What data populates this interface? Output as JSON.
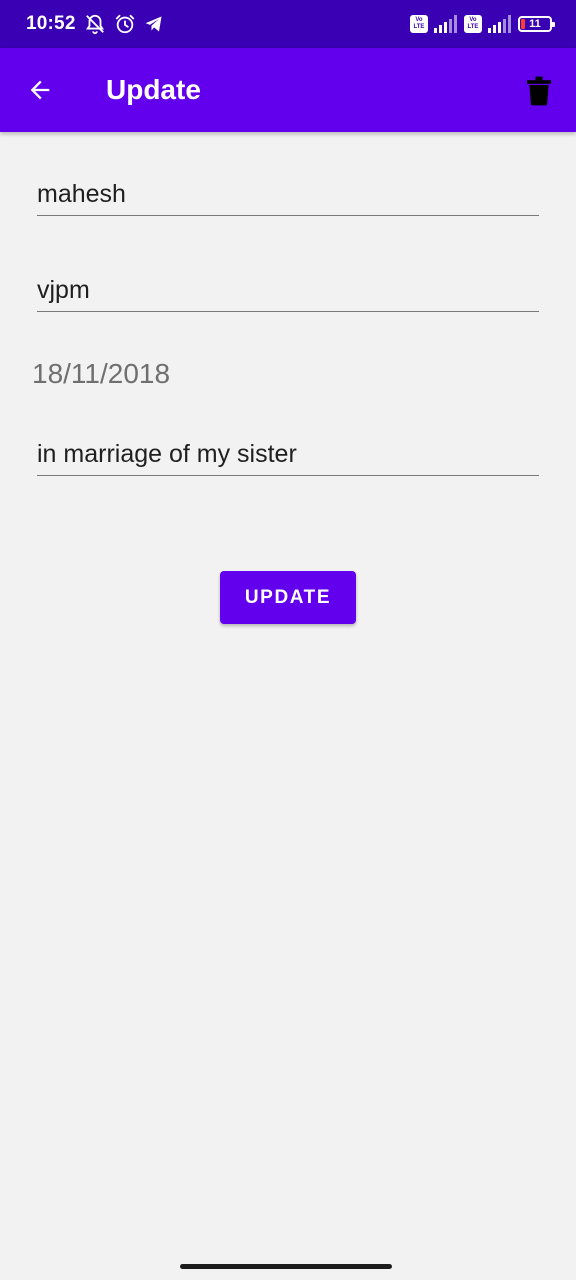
{
  "status_bar": {
    "time": "10:52",
    "left_icons": [
      "mute-notification-icon",
      "alarm-icon",
      "telegram-icon"
    ],
    "volte_1": {
      "top": "Vo",
      "bottom": "LTE"
    },
    "volte_2": {
      "top": "Vo",
      "bottom": "LTE"
    },
    "battery_level": "11"
  },
  "app_bar": {
    "title": "Update",
    "back_icon": "arrow-back-icon",
    "delete_icon": "trash-icon"
  },
  "form": {
    "name_value": "mahesh",
    "place_value": "vjpm",
    "date_value": "18/11/2018",
    "reason_value": "in marriage of my sister",
    "submit_label": "UPDATE"
  },
  "colors": {
    "status_bar": "#3a00b3",
    "primary": "#6200ee",
    "background": "#f2f2f2"
  }
}
